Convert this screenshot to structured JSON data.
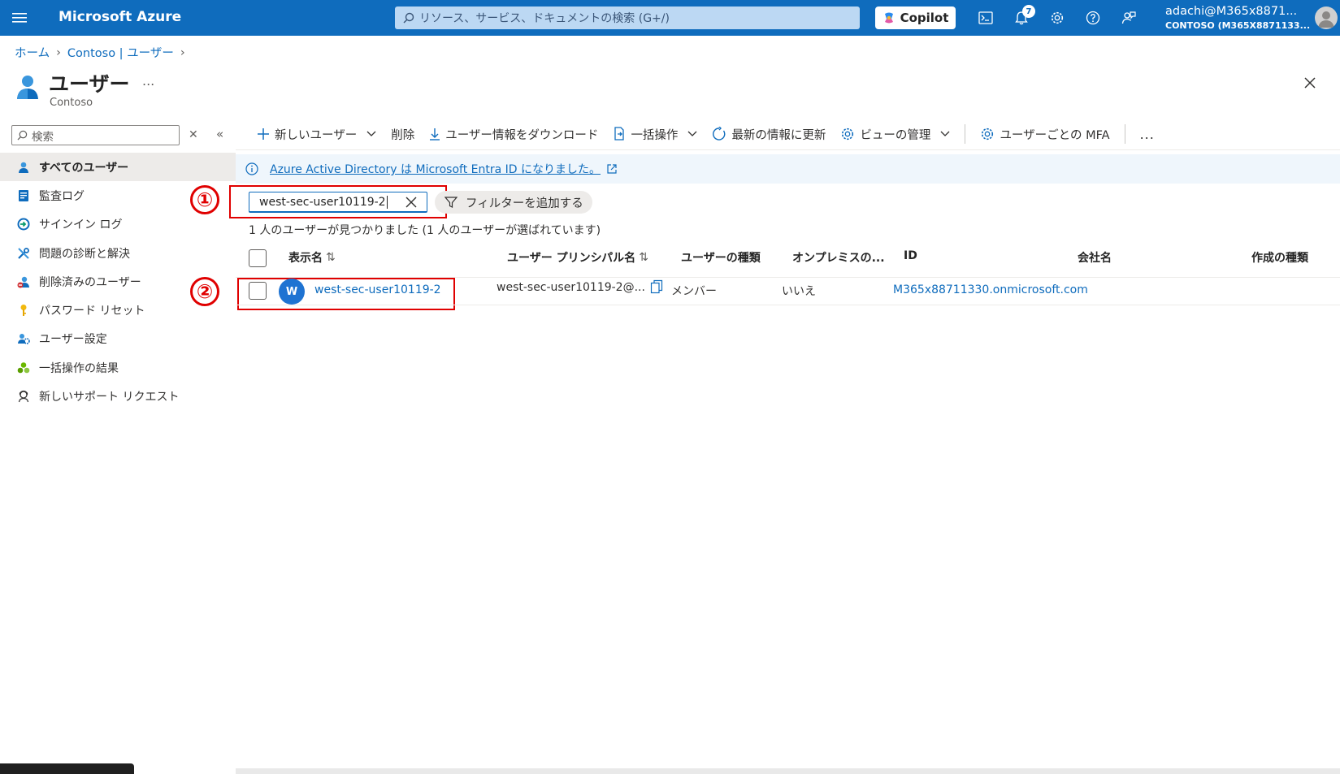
{
  "topbar": {
    "brand": "Microsoft Azure",
    "search_placeholder": "リソース、サービス、ドキュメントの検索 (G+/)",
    "copilot_label": "Copilot",
    "notification_count": "7",
    "account_name": "adachi@M365x8871...",
    "account_tenant": "CONTOSO (M365X8871133...",
    "accent_color": "#0f6cbd"
  },
  "breadcrumb": {
    "items": [
      "ホーム",
      "Contoso | ユーザー"
    ]
  },
  "header": {
    "title": "ユーザー",
    "more": "...",
    "subtitle": "Contoso"
  },
  "sidebar": {
    "search_placeholder": "検索",
    "items": [
      {
        "label": "すべてのユーザー",
        "icon": "user-icon",
        "active": true
      },
      {
        "label": "監査ログ",
        "icon": "audit-log-icon"
      },
      {
        "label": "サインイン ログ",
        "icon": "sign-in-icon"
      },
      {
        "label": "問題の診断と解決",
        "icon": "wrench-icon"
      },
      {
        "label": "削除済みのユーザー",
        "icon": "deleted-user-icon"
      },
      {
        "label": "パスワード リセット",
        "icon": "key-icon"
      },
      {
        "label": "ユーザー設定",
        "icon": "user-settings-icon"
      },
      {
        "label": "一括操作の結果",
        "icon": "bulk-results-icon"
      },
      {
        "label": "新しいサポート リクエスト",
        "icon": "support-icon"
      }
    ]
  },
  "commands": {
    "new_user": "新しいユーザー",
    "delete": "削除",
    "download": "ユーザー情報をダウンロード",
    "bulk": "一括操作",
    "refresh": "最新の情報に更新",
    "manage_view": "ビューの管理",
    "per_user_mfa": "ユーザーごとの MFA",
    "more": "..."
  },
  "banner": {
    "text": "Azure Active Directory は Microsoft Entra ID になりました。"
  },
  "filter": {
    "search_value": "west-sec-user10119-2",
    "add_filter": "フィルターを追加する",
    "result_text": "1 人のユーザーが見つかりました (1 人のユーザーが選ばれています)"
  },
  "annotations": [
    "①",
    "②"
  ],
  "table": {
    "columns": [
      "表示名",
      "ユーザー プリンシパル名",
      "ユーザーの種類",
      "オンプレミスの...",
      "ID",
      "会社名",
      "作成の種類"
    ],
    "rows": [
      {
        "avatar": "W",
        "display_name": "west-sec-user10119-2",
        "upn": "west-sec-user10119-2@...",
        "user_type": "メンバー",
        "on_prem": "いいえ",
        "identity": "M365x88711330.onmicrosoft.com",
        "company": "",
        "creation_type": ""
      }
    ]
  }
}
